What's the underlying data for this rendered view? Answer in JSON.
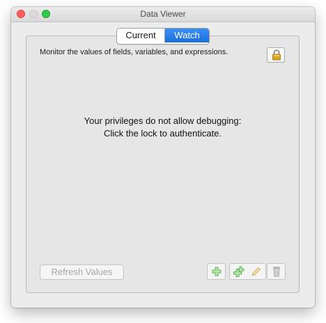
{
  "window": {
    "title": "Data Viewer",
    "controls": [
      "close-icon",
      "minimize-icon",
      "zoom-icon"
    ]
  },
  "tabs": [
    {
      "label": "Current",
      "selected": false
    },
    {
      "label": "Watch",
      "selected": true
    }
  ],
  "description": "Monitor the values of fields, variables, and expressions.",
  "lock": {
    "icon": "lock-icon",
    "state": "locked"
  },
  "message": {
    "line1": "Your privileges do not allow debugging:",
    "line2": "Click the lock to authenticate."
  },
  "buttons": {
    "refresh_label": "Refresh Values",
    "refresh_enabled": false,
    "add_icon": "add-icon",
    "add_multiple_icon": "add-multiple-icon",
    "edit_icon": "pencil-icon",
    "delete_icon": "trash-icon"
  },
  "colors": {
    "selected_tab": "#1a6fd9",
    "window_background": "#ececec",
    "add_icon": "#5fb85a",
    "lock_gold": "#d9a521"
  }
}
